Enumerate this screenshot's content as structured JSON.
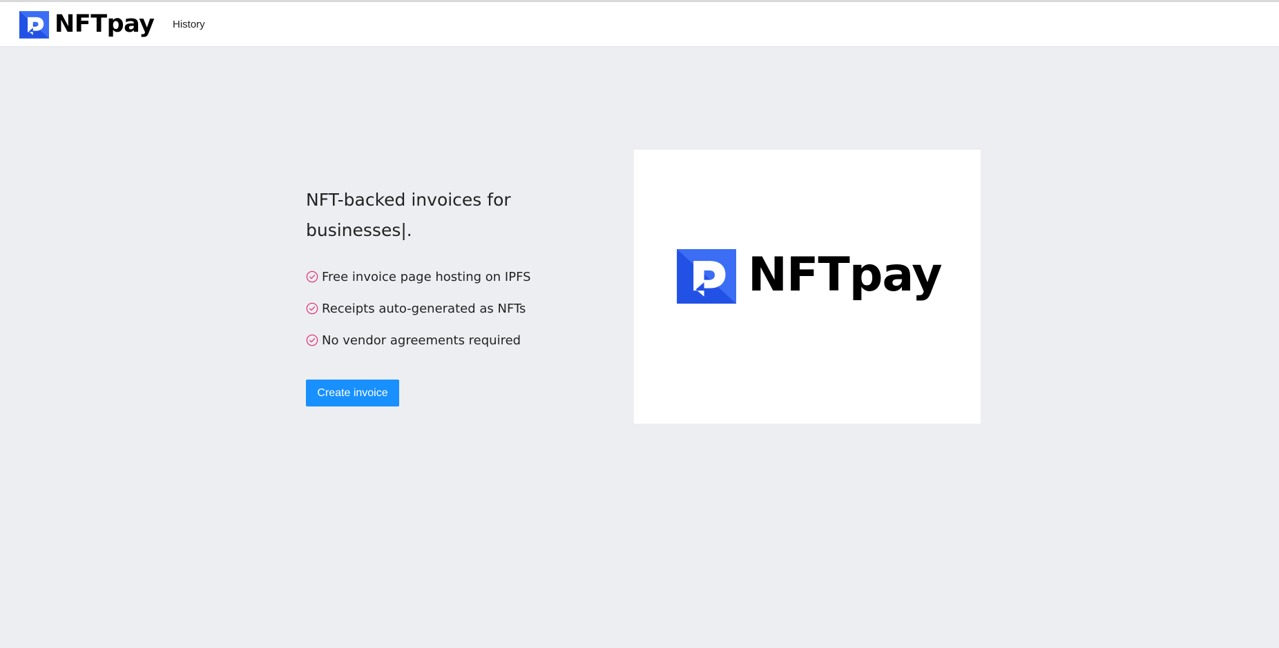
{
  "brand": {
    "name": "NFTpay",
    "primary_blue": "#2251e6",
    "accent_blue": "#3b6ef5"
  },
  "nav": {
    "history_label": "History"
  },
  "hero": {
    "title": "NFT-backed invoices for businesses|.",
    "features": [
      "Free invoice page hosting on IPFS",
      "Receipts auto-generated as NFTs",
      "No vendor agreements required"
    ],
    "feature_icon": "check-circle-icon",
    "feature_icon_color": "#e0357a",
    "cta_label": "Create invoice",
    "cta_color": "#1890ff"
  },
  "background_color": "#edeef2"
}
